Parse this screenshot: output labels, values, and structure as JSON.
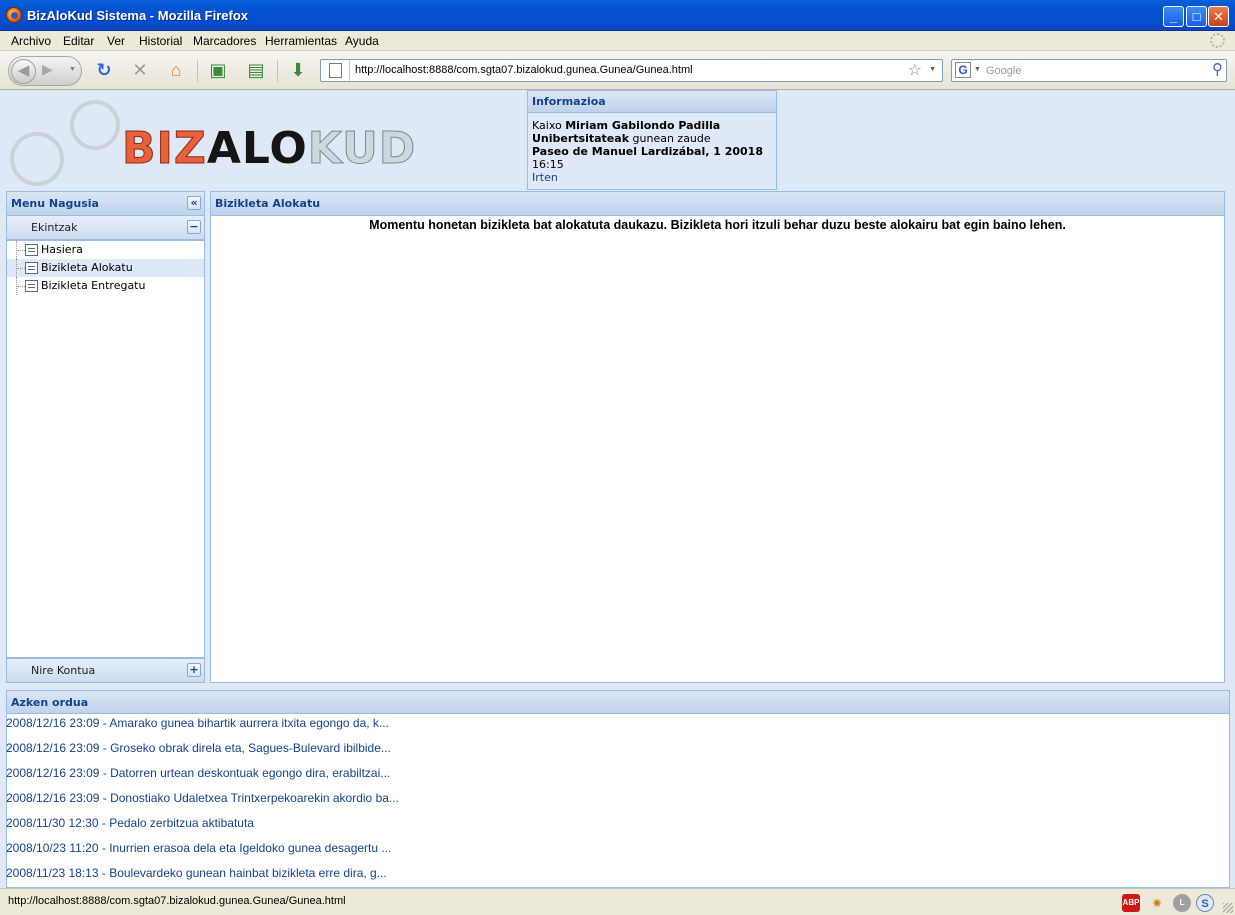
{
  "window": {
    "title": "BizAloKud Sistema - Mozilla Firefox"
  },
  "menubar": {
    "items": [
      "Archivo",
      "Editar",
      "Ver",
      "Historial",
      "Marcadores",
      "Herramientas",
      "Ayuda"
    ]
  },
  "navbar": {
    "url": "http://localhost:8888/com.sgta07.bizalokud.gunea.Gunea/Gunea.html",
    "search_placeholder": "Google"
  },
  "logo": {
    "part1": "BIZ",
    "part2": "ALO",
    "part3": "KUD"
  },
  "info": {
    "title": "Informazioa",
    "greeting_prefix": "Kaixo",
    "user_name": "Miriam Gabilondo Padilla",
    "location_name": "Unibertsitateak",
    "location_suffix": "gunean zaude",
    "address": "Paseo de Manuel Lardizábal, 1 20018",
    "time": "16:15",
    "logout": "Irten"
  },
  "menu": {
    "title": "Menu Nagusia",
    "section_actions": "Ekintzak",
    "items": [
      "Hasiera",
      "Bizikleta Alokatu",
      "Bizikleta Entregatu"
    ],
    "section_account": "Nire Kontua"
  },
  "main": {
    "title": "Bizikleta Alokatu",
    "message": "Momentu honetan bizikleta bat alokatuta daukazu. Bizikleta hori itzuli behar duzu beste alokairu bat egin baino lehen."
  },
  "news": {
    "title": "Azken ordua",
    "items": [
      "2008/12/16 23:09 - Amarako gunea bihartik aurrera itxita egongo da, k...",
      "2008/12/16 23:09 - Groseko obrak direla eta, Sagues-Bulevard ibilbide...",
      "2008/12/16 23:09 - Datorren urtean deskontuak egongo dira, erabiltzai...",
      "2008/12/16 23:09 - Donostiako Udaletxea Trintxerpekoarekin akordio ba...",
      "2008/11/30 12:30 - Pedalo zerbitzua aktibatuta",
      "2008/10/23 11:20 - Inurrien erasoa dela eta Igeldoko gunea desagertu ...",
      "2008/11/23 18:13 - Boulevardeko gunean hainbat bizikleta erre dira, g..."
    ]
  },
  "status": {
    "text": "http://localhost:8888/com.sgta07.bizalokud.gunea.Gunea/Gunea.html",
    "icons": [
      "ABP",
      "S"
    ]
  },
  "colors": {
    "panel_header_text": "#15428b",
    "panel_border": "#99bbe8",
    "page_background": "#dfe8f6",
    "logo_red": "#e8613d"
  }
}
